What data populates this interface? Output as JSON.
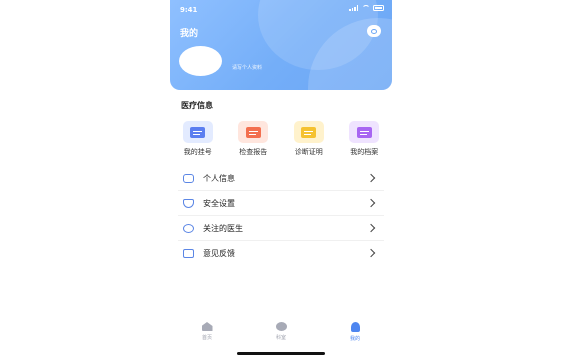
{
  "status_bar": {
    "time": "9:41"
  },
  "header": {
    "title": "我的",
    "edit_profile": "请写个人资料",
    "eye_icon": "eye-icon"
  },
  "medical_section": {
    "title": "医疗信息",
    "items": [
      {
        "label": "我的挂号",
        "icon": "registration-icon",
        "bg": "#e3ebff",
        "fg": "#5b7ef0"
      },
      {
        "label": "检查报告",
        "icon": "report-icon",
        "bg": "#ffe6de",
        "fg": "#f36f4f"
      },
      {
        "label": "诊断证明",
        "icon": "certificate-icon",
        "bg": "#fff2cc",
        "fg": "#f5c230"
      },
      {
        "label": "我的档案",
        "icon": "archive-icon",
        "bg": "#efe3ff",
        "fg": "#a865f2"
      }
    ]
  },
  "settings_list": [
    {
      "label": "个人信息",
      "icon": "person-info-icon"
    },
    {
      "label": "安全设置",
      "icon": "shield-icon"
    },
    {
      "label": "关注的医生",
      "icon": "eye-icon"
    },
    {
      "label": "意见反馈",
      "icon": "feedback-icon"
    }
  ],
  "tab_bar": [
    {
      "label": "首页",
      "icon": "home-icon"
    },
    {
      "label": "科室",
      "icon": "department-icon"
    },
    {
      "label": "我的",
      "icon": "profile-icon",
      "active": true
    }
  ],
  "colors": {
    "accent": "#4e86f0",
    "header_gradient_start": "#8fc0ff",
    "header_gradient_end": "#6ba6f5"
  }
}
